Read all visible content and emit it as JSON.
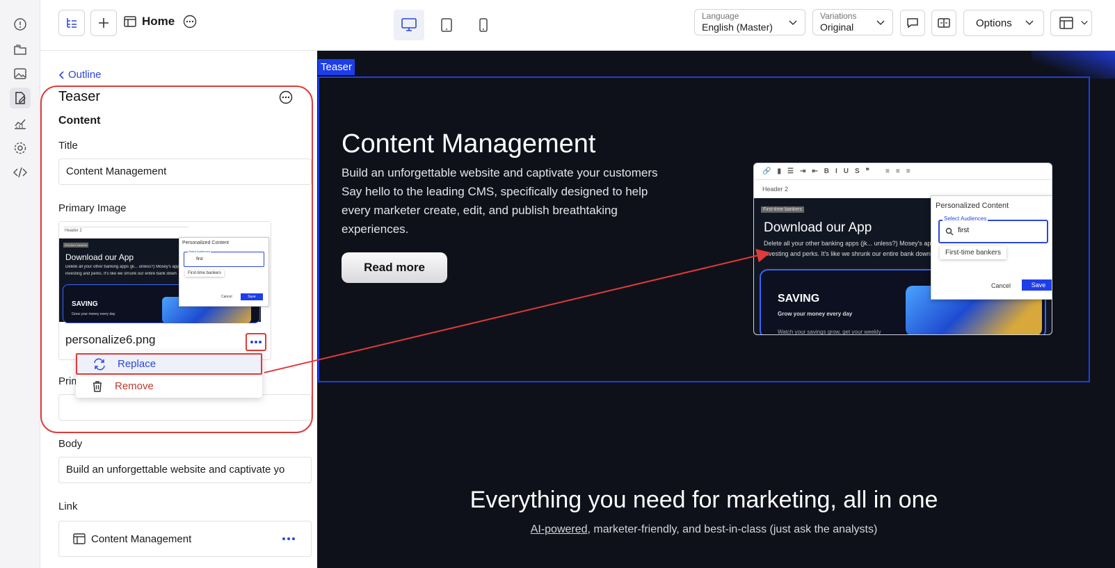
{
  "topbar": {
    "page_title": "Home",
    "language": {
      "label": "Language",
      "value": "English (Master)"
    },
    "variations": {
      "label": "Variations",
      "value": "Original"
    },
    "options_label": "Options"
  },
  "panel": {
    "back_label": "Outline",
    "title": "Teaser",
    "section": "Content",
    "title_label": "Title",
    "title_value": "Content Management",
    "primary_image_label": "Primary Image",
    "image_filename": "personalize6.png",
    "primary_partial_label": "Prim",
    "body_label": "Body",
    "body_value": "Build an unforgettable website and captivate yo",
    "link_label": "Link",
    "link_value": "Content Management"
  },
  "menu": {
    "replace": "Replace",
    "remove": "Remove"
  },
  "thumb": {
    "header_select": "Header 2",
    "banner_tag": "First-time bankers",
    "heading": "Download our App",
    "text_line1": "Delete all your other banking apps (jk... unless?) Mosey's app",
    "text_line2": "investing and perks. It's like we shrunk our entire bank down",
    "popup_title": "Personalized Content",
    "popup_field_label": "Select Audiences",
    "popup_query": "first",
    "popup_option": "First-time bankers",
    "cancel": "Cancel",
    "save": "Save",
    "saving": "SAVING",
    "saving_sub": "Grow your money every day",
    "saving_more": "Watch your savings grow, get your weekly"
  },
  "canvas": {
    "teaser_tag": "Teaser",
    "hero_title": "Content Management",
    "hero_body": "Build an unforgettable website and captivate your customers Say hello to the leading CMS, specifically designed to help every marketer create, edit, and publish breathtaking experiences.",
    "read_more": "Read more",
    "section2_title": "Everything you need for marketing, all in one",
    "section2_link": "AI-powered",
    "section2_rest": ", marketer-friendly, and best-in-class (just ask the analysts)"
  },
  "colors": {
    "accent": "#1d3ee8",
    "annotation": "#e03a3a",
    "canvas_bg": "#0f111a"
  }
}
